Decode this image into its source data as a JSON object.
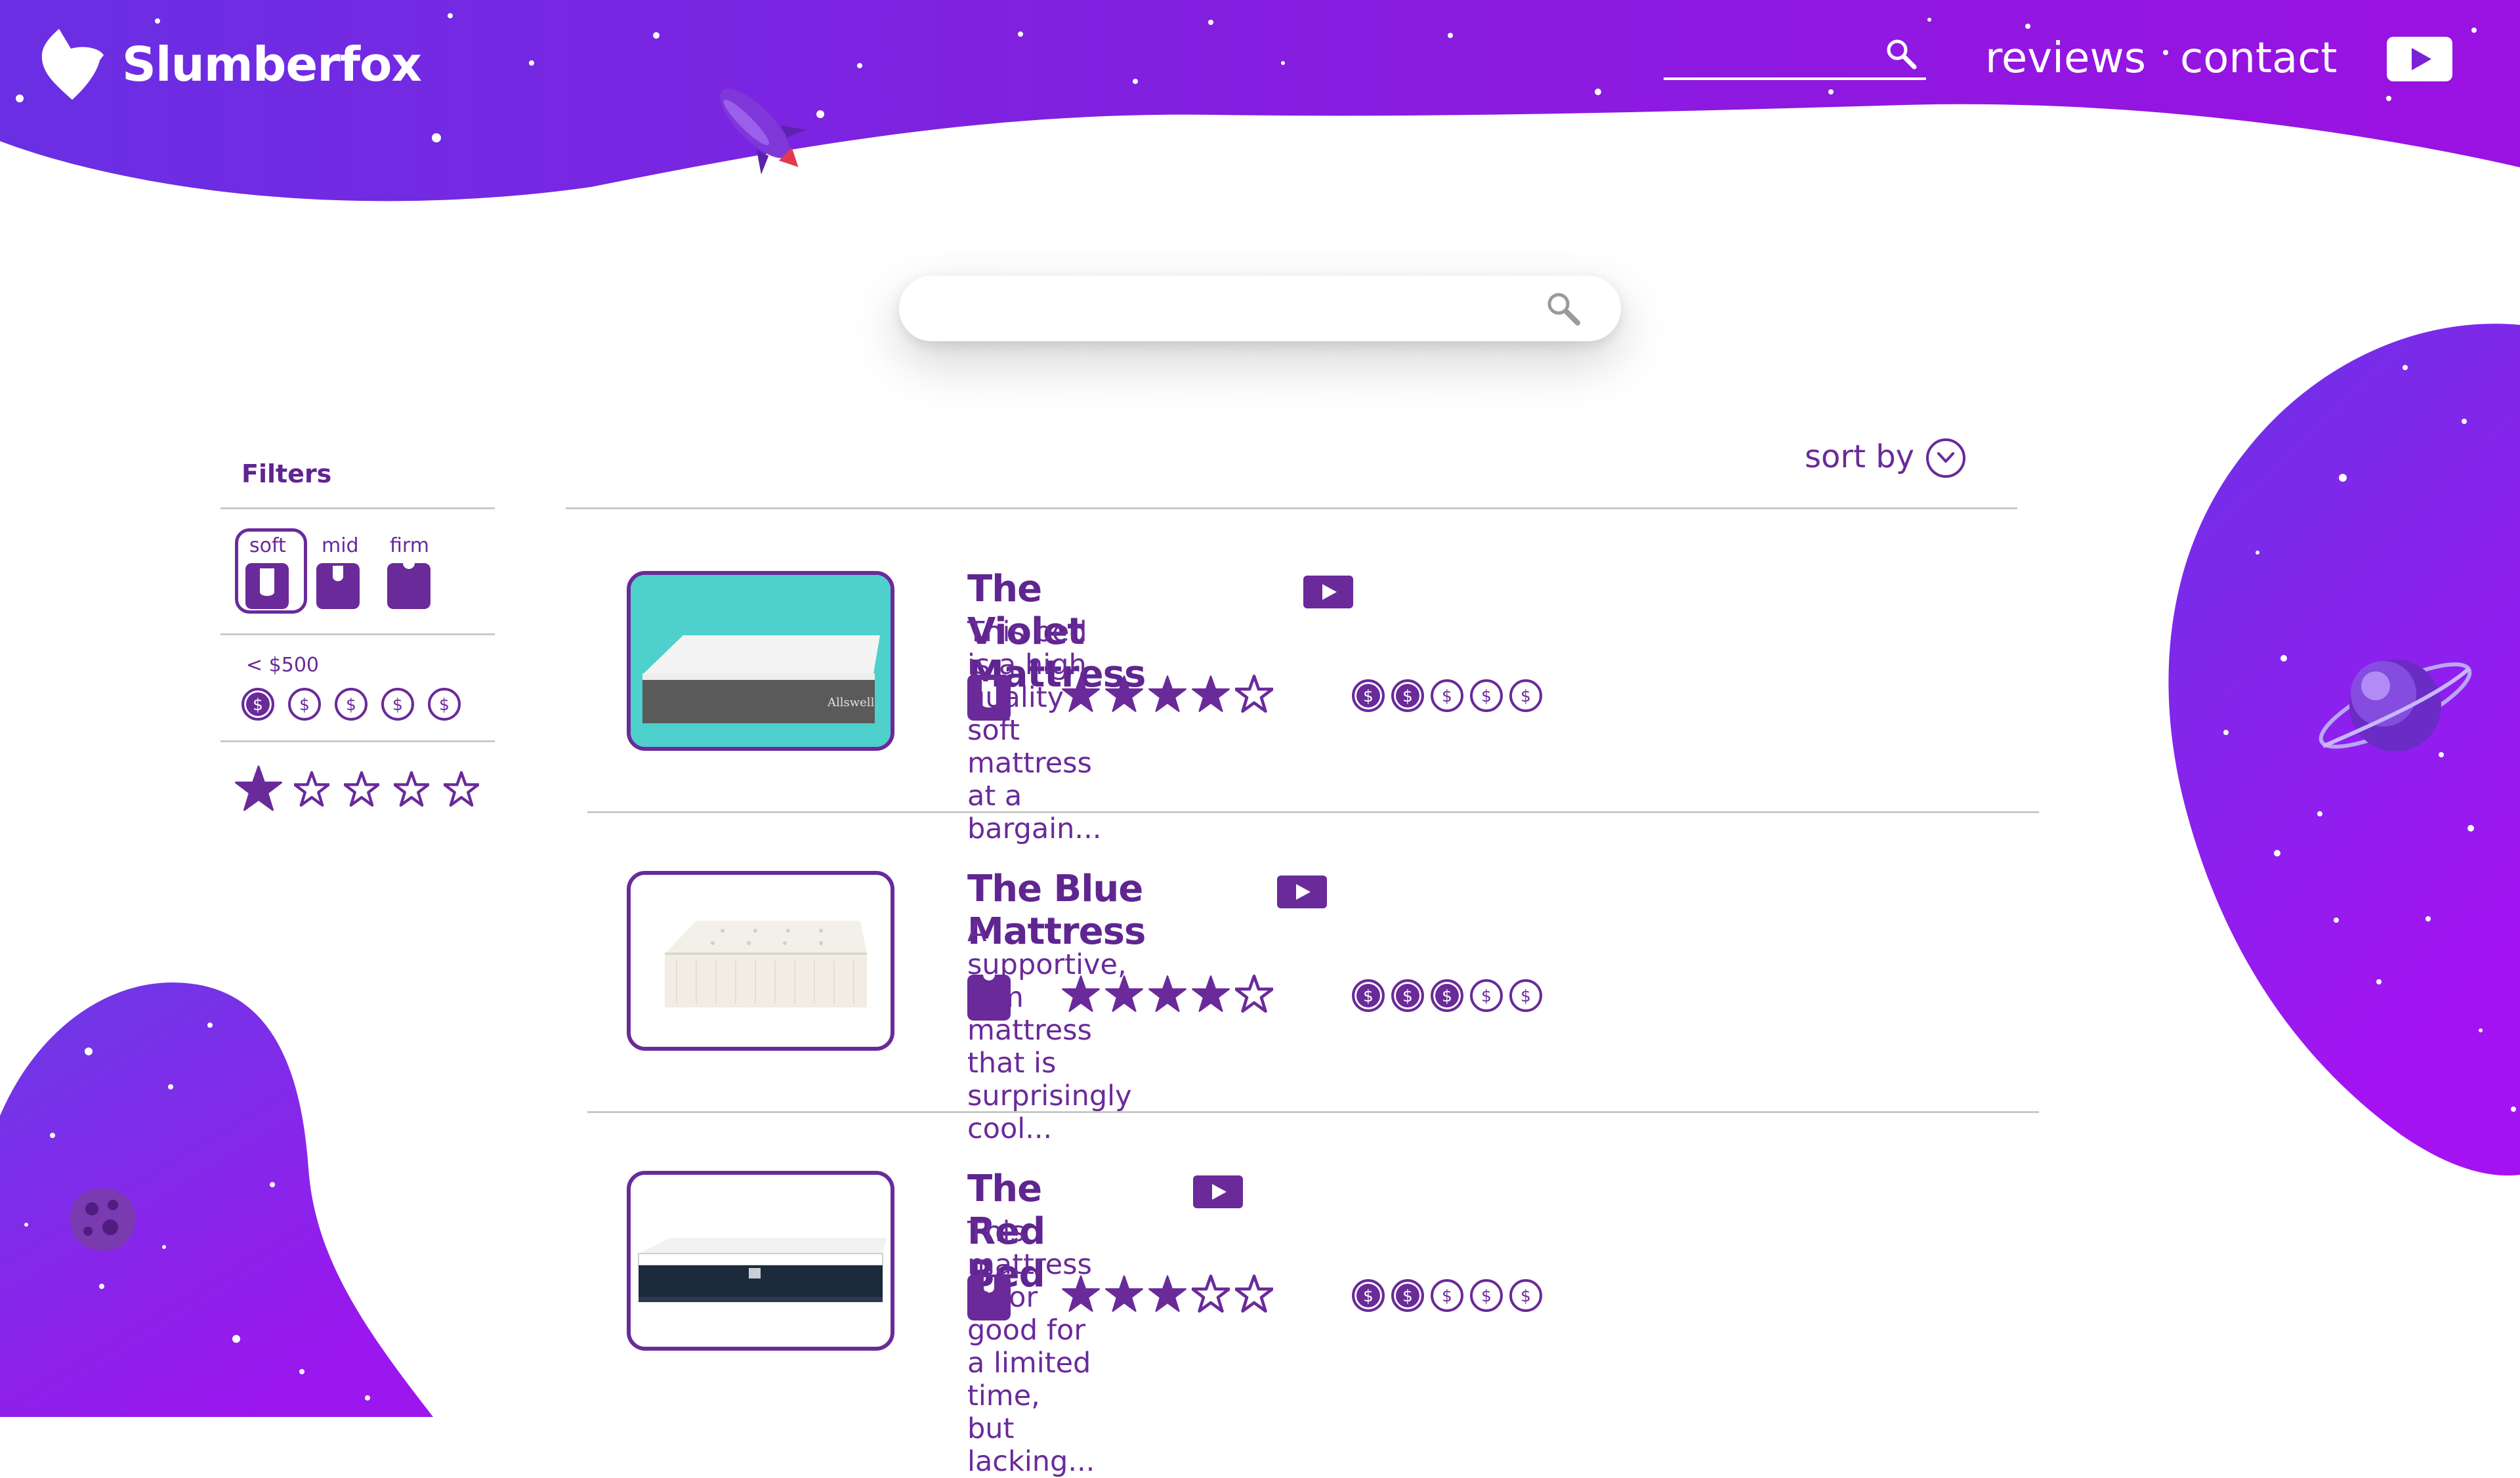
{
  "brand": {
    "name": "Slumberfox"
  },
  "header": {
    "search_placeholder": "",
    "nav": {
      "reviews": "reviews",
      "contact": "contact"
    }
  },
  "search": {
    "placeholder": ""
  },
  "filters": {
    "title": "Filters",
    "firmness": [
      {
        "label": "soft",
        "selected": true
      },
      {
        "label": "mid",
        "selected": false
      },
      {
        "label": "firm",
        "selected": false
      }
    ],
    "price_label": "< $500",
    "price_selected": 1,
    "price_max": 5,
    "rating_selected": 1,
    "rating_max": 5
  },
  "sort": {
    "label": "sort by"
  },
  "products": [
    {
      "title": "The Violet Mattress",
      "description": "This bed is a high quality soft mattress at a bargain...",
      "firmness": "soft",
      "rating": 4,
      "price_level": 2,
      "image_icon": "mattress-image-gray-on-teal",
      "brand_mark": "Allswell"
    },
    {
      "title": "The Blue Mattress",
      "description": "A supportive, firm mattress that is surprisingly cool...",
      "firmness": "firm",
      "rating": 4,
      "price_level": 3,
      "image_icon": "mattress-image-white-tufted"
    },
    {
      "title": "The Red Bed",
      "description": "This mattress is for good for a limited time, but lacking...",
      "firmness": "mid",
      "rating": 3,
      "price_level": 2,
      "image_icon": "mattress-image-navy-white"
    }
  ],
  "colors": {
    "accent": "#6a2a9a",
    "gradient_start": "#6a2ee6",
    "gradient_end": "#a015e6",
    "rule": "#c9c9c9"
  },
  "icons": [
    "fox-logo-icon",
    "search-icon",
    "play-icon",
    "rocket-icon",
    "planet-icon",
    "asteroid-icon",
    "chevron-down-icon",
    "star-icon",
    "dollar-coin-icon",
    "firmness-icon"
  ]
}
